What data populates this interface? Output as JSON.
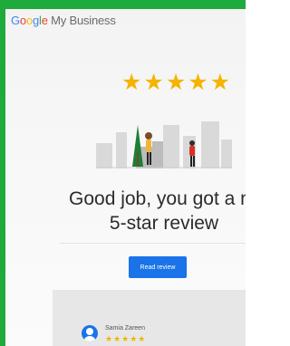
{
  "brand": {
    "g": "G",
    "o1": "o",
    "o2": "o",
    "g2": "g",
    "l": "l",
    "e": "e",
    "rest": " My Business"
  },
  "rating": {
    "stars_text": "★★★★★",
    "count": 5
  },
  "headline": {
    "line1": "Good job, you got a new",
    "line2": "5-star review"
  },
  "button": {
    "label": "Read review"
  },
  "review": {
    "name": "Samia Zareen",
    "stars_text": "★★★★★"
  },
  "colors": {
    "frame": "#1faa3c",
    "accent": "#1a73e8",
    "star": "#f4b400"
  },
  "icons": {
    "avatar": "person-avatar-icon"
  }
}
